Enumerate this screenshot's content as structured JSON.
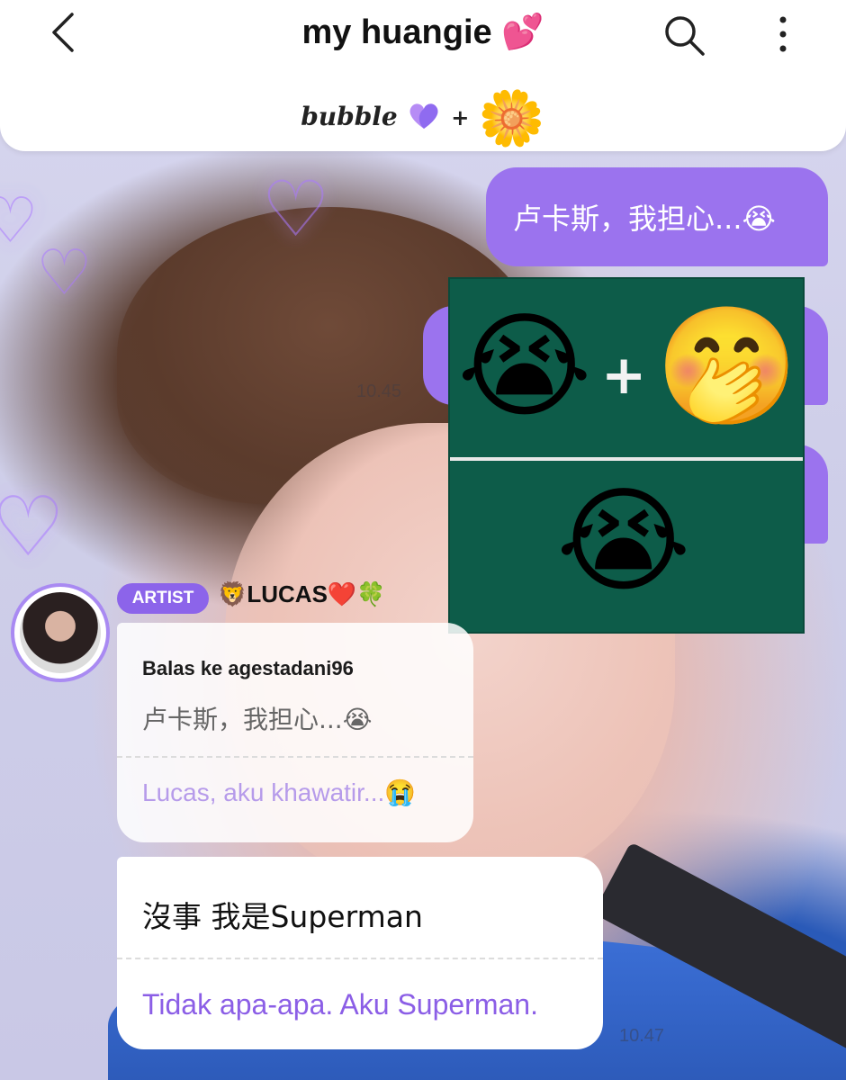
{
  "header": {
    "title": "my huangie 💕",
    "subtitle_text": "bubble",
    "subtitle_plus": "+",
    "subtitle_emoji": "🌼",
    "back_icon": "chevron-left-icon",
    "search_icon": "search-icon",
    "more_icon": "more-vertical-icon"
  },
  "messages_out": [
    {
      "text": "卢卡斯，我担心...😭"
    },
    {
      "text": ""
    },
    {
      "text": ""
    }
  ],
  "timestamps": {
    "t1": "10.45",
    "t2": "10.47"
  },
  "meme": {
    "emoji_crying": "😭",
    "plus": "+",
    "emoji_shy": "🤭",
    "emoji_combined": "😭"
  },
  "artist": {
    "badge": "ARTIST",
    "name": "🦁LUCAS❤️🍀"
  },
  "reply_card": {
    "reply_to": "Balas ke agestadani96",
    "quote": "卢卡斯，我担心...😭",
    "translation": "Lucas, aku khawatir...😭"
  },
  "message_card": {
    "text": "沒事 我是Superman",
    "translation": "Tidak apa-apa. Aku Superman."
  },
  "colors": {
    "accent": "#9b73ee",
    "badge": "#8c64ea",
    "translation": "#8b5ee6",
    "meme_bg": "#0d5c49"
  }
}
